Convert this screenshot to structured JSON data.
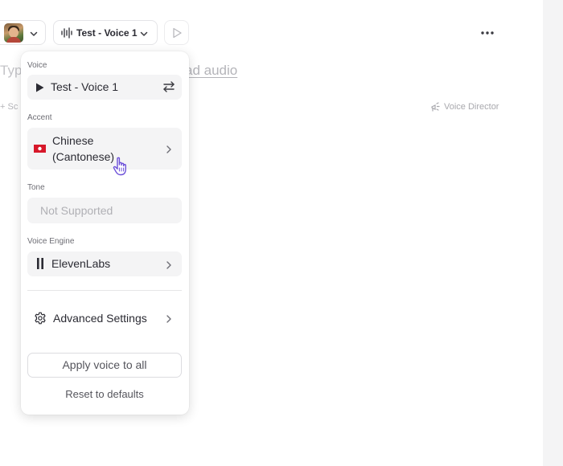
{
  "toolbar": {
    "voice_label": "Test - Voice 1"
  },
  "editor": {
    "placeholder_partial": "Typ",
    "upload_partial": "ad audio",
    "scene_partial": "+ Sc",
    "voice_director_label": "Voice Director"
  },
  "popup": {
    "voice": {
      "label": "Voice",
      "value": "Test - Voice 1"
    },
    "accent": {
      "label": "Accent",
      "value_line1": "Chinese",
      "value_line2": "(Cantonese)",
      "flag": "hong-kong-flag"
    },
    "tone": {
      "label": "Tone",
      "value": "Not Supported"
    },
    "engine": {
      "label": "Voice Engine",
      "value": "ElevenLabs"
    },
    "advanced_label": "Advanced Settings",
    "apply_label": "Apply voice to all",
    "reset_label": "Reset to defaults"
  },
  "colors": {
    "panel_bg": "#f4f4f5",
    "field_bg": "#f4f4f5",
    "flag_red": "#d7182a",
    "cursor_accent": "#6b4fd8"
  }
}
